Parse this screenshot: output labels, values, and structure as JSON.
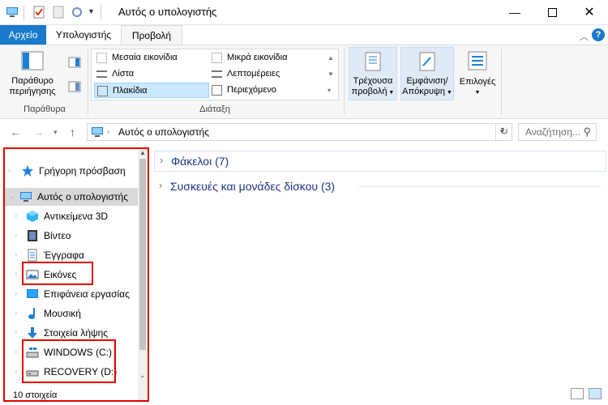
{
  "window": {
    "title": "Αυτός ο υπολογιστής"
  },
  "tabs": {
    "file": "Αρχείο",
    "computer": "Υπολογιστής",
    "view": "Προβολή"
  },
  "ribbon": {
    "panes": {
      "navpane_label_1": "Παράθυρο",
      "navpane_label_2": "περιήγησης",
      "group_label": "Παράθυρα"
    },
    "layout": {
      "items": [
        "Μεσαία εικονίδια",
        "Μικρά εικονίδια",
        "Λίστα",
        "Λεπτομέρειες",
        "Πλακίδια",
        "Περιεχόμενο"
      ],
      "selected": "Πλακίδια",
      "group_label": "Διάταξη"
    },
    "current_view": {
      "line1": "Τρέχουσα",
      "line2": "προβολή"
    },
    "show_hide": {
      "line1": "Εμφάνιση/",
      "line2": "Απόκρυψη"
    },
    "options": "Επιλογές"
  },
  "address": {
    "path": "Αυτός ο υπολογιστής",
    "search_placeholder": "Αναζήτηση..."
  },
  "navpane": {
    "items": [
      {
        "label": "Γρήγορη πρόσβαση",
        "icon": "star-icon"
      },
      {
        "label": "Αυτός ο υπολογιστής",
        "icon": "computer-icon"
      },
      {
        "label": "Αντικείμενα 3D",
        "icon": "cube-icon"
      },
      {
        "label": "Βίντεο",
        "icon": "film-icon"
      },
      {
        "label": "Έγγραφα",
        "icon": "document-icon"
      },
      {
        "label": "Εικόνες",
        "icon": "pictures-icon"
      },
      {
        "label": "Επιφάνεια εργασίας",
        "icon": "desktop-icon"
      },
      {
        "label": "Μουσική",
        "icon": "music-icon"
      },
      {
        "label": "Στοιχεία λήψης",
        "icon": "download-icon"
      },
      {
        "label": "WINDOWS (C:)",
        "icon": "drive-c-icon"
      },
      {
        "label": "RECOVERY (D:)",
        "icon": "drive-d-icon"
      }
    ]
  },
  "content": {
    "groups": [
      {
        "label": "Φάκελοι (7)"
      },
      {
        "label": "Συσκευές και μονάδες δίσκου (3)"
      }
    ]
  },
  "status": {
    "count": "10 στοιχεία"
  },
  "colors": {
    "accent": "#1979ca",
    "highlight_box": "#e00000",
    "group_text": "#1e3287"
  }
}
